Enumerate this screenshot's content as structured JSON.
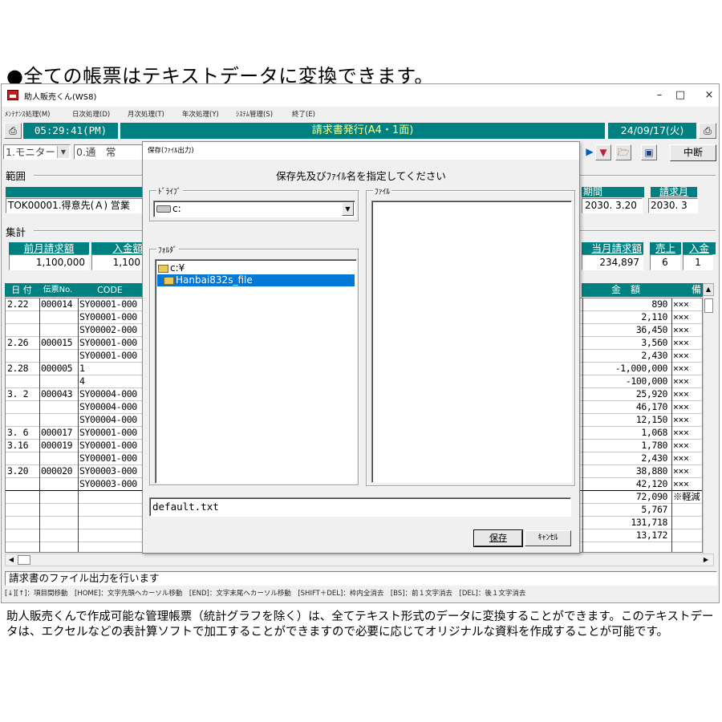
{
  "headline": "●全ての帳票はテキストデータに変換できます。",
  "footer_text": "助人販売くんで作成可能な管理帳票（統計グラフを除く）は、全てテキスト形式のデータに変換することができます。このテキストデータは、エクセルなどの表計算ソフトで加工することができますので必要に応じてオリジナルな資料を作成することが可能です。",
  "app": {
    "title": "助人販売くん(WS8)",
    "minimize": "–",
    "maximize": "□",
    "close": "×"
  },
  "menu": [
    "ﾒﾝﾃﾅﾝｽ処理(M)",
    "日次処理(D)",
    "月次処理(T)",
    "年次処理(Y)",
    "ｼｽﾃﾑ管理(S)",
    "終了(E)"
  ],
  "header": {
    "time": "05:29:41(PM)",
    "title": "請求書発行(A4・1面)",
    "date": "24/09/17(火)"
  },
  "filters": {
    "monitor": "1.モニター",
    "mode": "0.通　常"
  },
  "toolbar": {
    "abort": "中断"
  },
  "range": {
    "group_label": "範囲",
    "customer": "TOK00001.得意先(Ａ) 営業",
    "period_label": "期間",
    "period_value": "2030. 3.20",
    "month_label": "請求月",
    "month_value": "2030. 3"
  },
  "summary": {
    "group_label": "集計",
    "prev_label": "前月請求額",
    "prev_value": "1,100,000",
    "deposit_label": "入金額",
    "deposit_value": "1,100",
    "current_label": "当月請求額",
    "current_value": "234,897",
    "sales_label": "売上",
    "sales_value": "6",
    "deposit_count_label": "入金",
    "deposit_count_value": "1"
  },
  "table": {
    "headers": {
      "date": "日 付",
      "slip": "伝票No.",
      "code": "CODE",
      "amount": "金　額",
      "note": "備"
    },
    "rows": [
      {
        "date": " 2.22",
        "slip": "000014",
        "code": "SY00001-000",
        "amount": "890",
        "note": "×××"
      },
      {
        "date": "",
        "slip": "",
        "code": "SY00001-000",
        "amount": "2,110",
        "note": "×××"
      },
      {
        "date": "",
        "slip": "",
        "code": "SY00002-000",
        "amount": "36,450",
        "note": "×××"
      },
      {
        "date": " 2.26",
        "slip": "000015",
        "code": "SY00001-000",
        "amount": "3,560",
        "note": "×××"
      },
      {
        "date": "",
        "slip": "",
        "code": "SY00001-000",
        "amount": "2,430",
        "note": "×××"
      },
      {
        "date": " 2.28",
        "slip": "000005",
        "code": "1",
        "amount": "-1,000,000",
        "note": "×××"
      },
      {
        "date": "",
        "slip": "",
        "code": "4",
        "amount": "-100,000",
        "note": "×××"
      },
      {
        "date": " 3. 2",
        "slip": "000043",
        "code": "SY00004-000",
        "amount": "25,920",
        "note": "×××"
      },
      {
        "date": "",
        "slip": "",
        "code": "SY00004-000",
        "amount": "46,170",
        "note": "×××"
      },
      {
        "date": "",
        "slip": "",
        "code": "SY00004-000",
        "amount": "12,150",
        "note": "×××"
      },
      {
        "date": " 3. 6",
        "slip": "000017",
        "code": "SY00001-000",
        "amount": "1,068",
        "note": "×××"
      },
      {
        "date": " 3.16",
        "slip": "000019",
        "code": "SY00001-000",
        "amount": "1,780",
        "note": "×××"
      },
      {
        "date": "",
        "slip": "",
        "code": "SY00001-000",
        "amount": "2,430",
        "note": "×××"
      },
      {
        "date": " 3.20",
        "slip": "000020",
        "code": "SY00003-000",
        "amount": "38,880",
        "note": "×××"
      },
      {
        "date": "",
        "slip": "",
        "code": "SY00003-000",
        "amount": "42,120",
        "note": "×××"
      },
      {
        "date": "",
        "slip": "",
        "code": "",
        "amount": "72,090",
        "note": "※軽減"
      },
      {
        "date": "",
        "slip": "",
        "code": "",
        "amount": "5,767",
        "note": ""
      },
      {
        "date": "",
        "slip": "",
        "code": "",
        "amount": "131,718",
        "note": ""
      },
      {
        "date": "",
        "slip": "",
        "code": "",
        "amount": "13,172",
        "note": ""
      }
    ]
  },
  "status": {
    "message": "請求書のファイル出力を行います",
    "keys": "[↓][↑]：項目間移動　[HOME]：文字先頭へカーソル移動　[END]：文字末尾へカーソル移動　[SHIFT＋DEL]：枠内全消去　[BS]：前１文字消去　[DEL]：後１文字消去"
  },
  "dialog": {
    "title": "保存(ﾌｧｲﾙ出力)",
    "prompt": "保存先及びﾌｧｲﾙ名を指定してください",
    "drive_label": "ﾄﾞﾗｲﾌﾞ",
    "drive_value": "c:",
    "folder_label": "ﾌｫﾙﾀﾞ",
    "folders": [
      "c:¥",
      "Hanbai832s_file"
    ],
    "file_label": "ﾌｧｲﾙ",
    "filename": "default.txt",
    "save": "保存",
    "cancel": "ｷｬﾝｾﾙ"
  }
}
